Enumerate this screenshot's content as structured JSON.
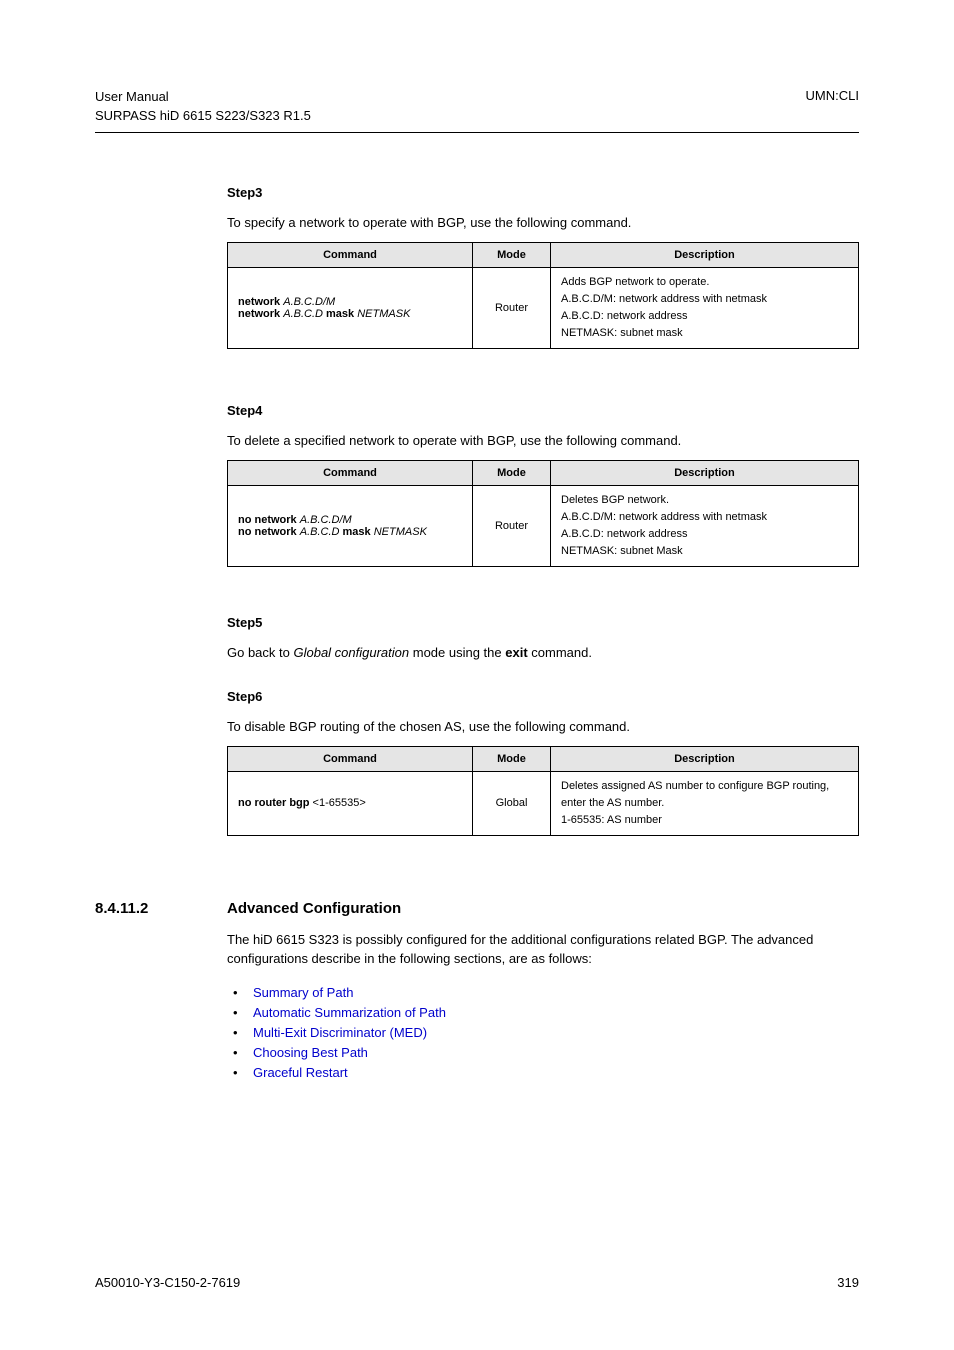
{
  "header": {
    "leftLine1": "User  Manual",
    "leftLine2": "SURPASS hiD 6615 S223/S323 R1.5",
    "right": "UMN:CLI"
  },
  "step3": {
    "label": "Step3",
    "intro": "To specify a network to operate with BGP, use the following command.",
    "headers": {
      "c1": "Command",
      "c2": "Mode",
      "c3": "Description"
    },
    "cmd": {
      "line1a": "network ",
      "line1b": "A.B.C.D/M",
      "line2a": "network ",
      "line2b": "A.B.C.D ",
      "line2c": "mask ",
      "line2d": "NETMASK"
    },
    "mode": "Router",
    "desc": {
      "l1": "Adds BGP network to operate.",
      "l2": "A.B.C.D/M: network address with netmask",
      "l3": "A.B.C.D: network address",
      "l4": "NETMASK: subnet mask"
    }
  },
  "step4": {
    "label": "Step4",
    "intro": "To delete a specified network to operate with BGP, use the following command.",
    "headers": {
      "c1": "Command",
      "c2": "Mode",
      "c3": "Description"
    },
    "cmd": {
      "line1a": "no network ",
      "line1b": "A.B.C.D/M",
      "line2a": "no network ",
      "line2b": "A.B.C.D ",
      "line2c": "mask ",
      "line2d": "NETMASK"
    },
    "mode": "Router",
    "desc": {
      "l1": "Deletes BGP network.",
      "l2": "A.B.C.D/M: network address with netmask",
      "l3": "A.B.C.D: network address",
      "l4": "NETMASK: subnet Mask"
    }
  },
  "step5": {
    "label": "Step5",
    "parts": {
      "p1": "Go back to ",
      "p2": "Global configuration",
      "p3": " mode using the ",
      "p4": "exit",
      "p5": " command."
    }
  },
  "step6": {
    "label": "Step6",
    "intro": "To disable BGP routing of the chosen AS, use the following command.",
    "headers": {
      "c1": "Command",
      "c2": "Mode",
      "c3": "Description"
    },
    "cmd": {
      "line1a": "no router bgp ",
      "line1b": "<1-65535>"
    },
    "mode": "Global",
    "desc": {
      "l1": "Deletes assigned AS number to configure BGP routing, enter the AS number.",
      "l2": "1-65535: AS number"
    }
  },
  "section": {
    "num": "8.4.11.2",
    "title": "Advanced Configuration",
    "para": "The hiD 6615 S323 is possibly configured for the additional configurations related BGP. The advanced configurations describe in the following sections, are as follows:",
    "items": [
      "Summary of Path",
      "Automatic Summarization of Path",
      "Multi-Exit Discriminator (MED)",
      "Choosing Best Path",
      "Graceful Restart"
    ]
  },
  "footer": {
    "left": "A50010-Y3-C150-2-7619",
    "right": "319"
  }
}
